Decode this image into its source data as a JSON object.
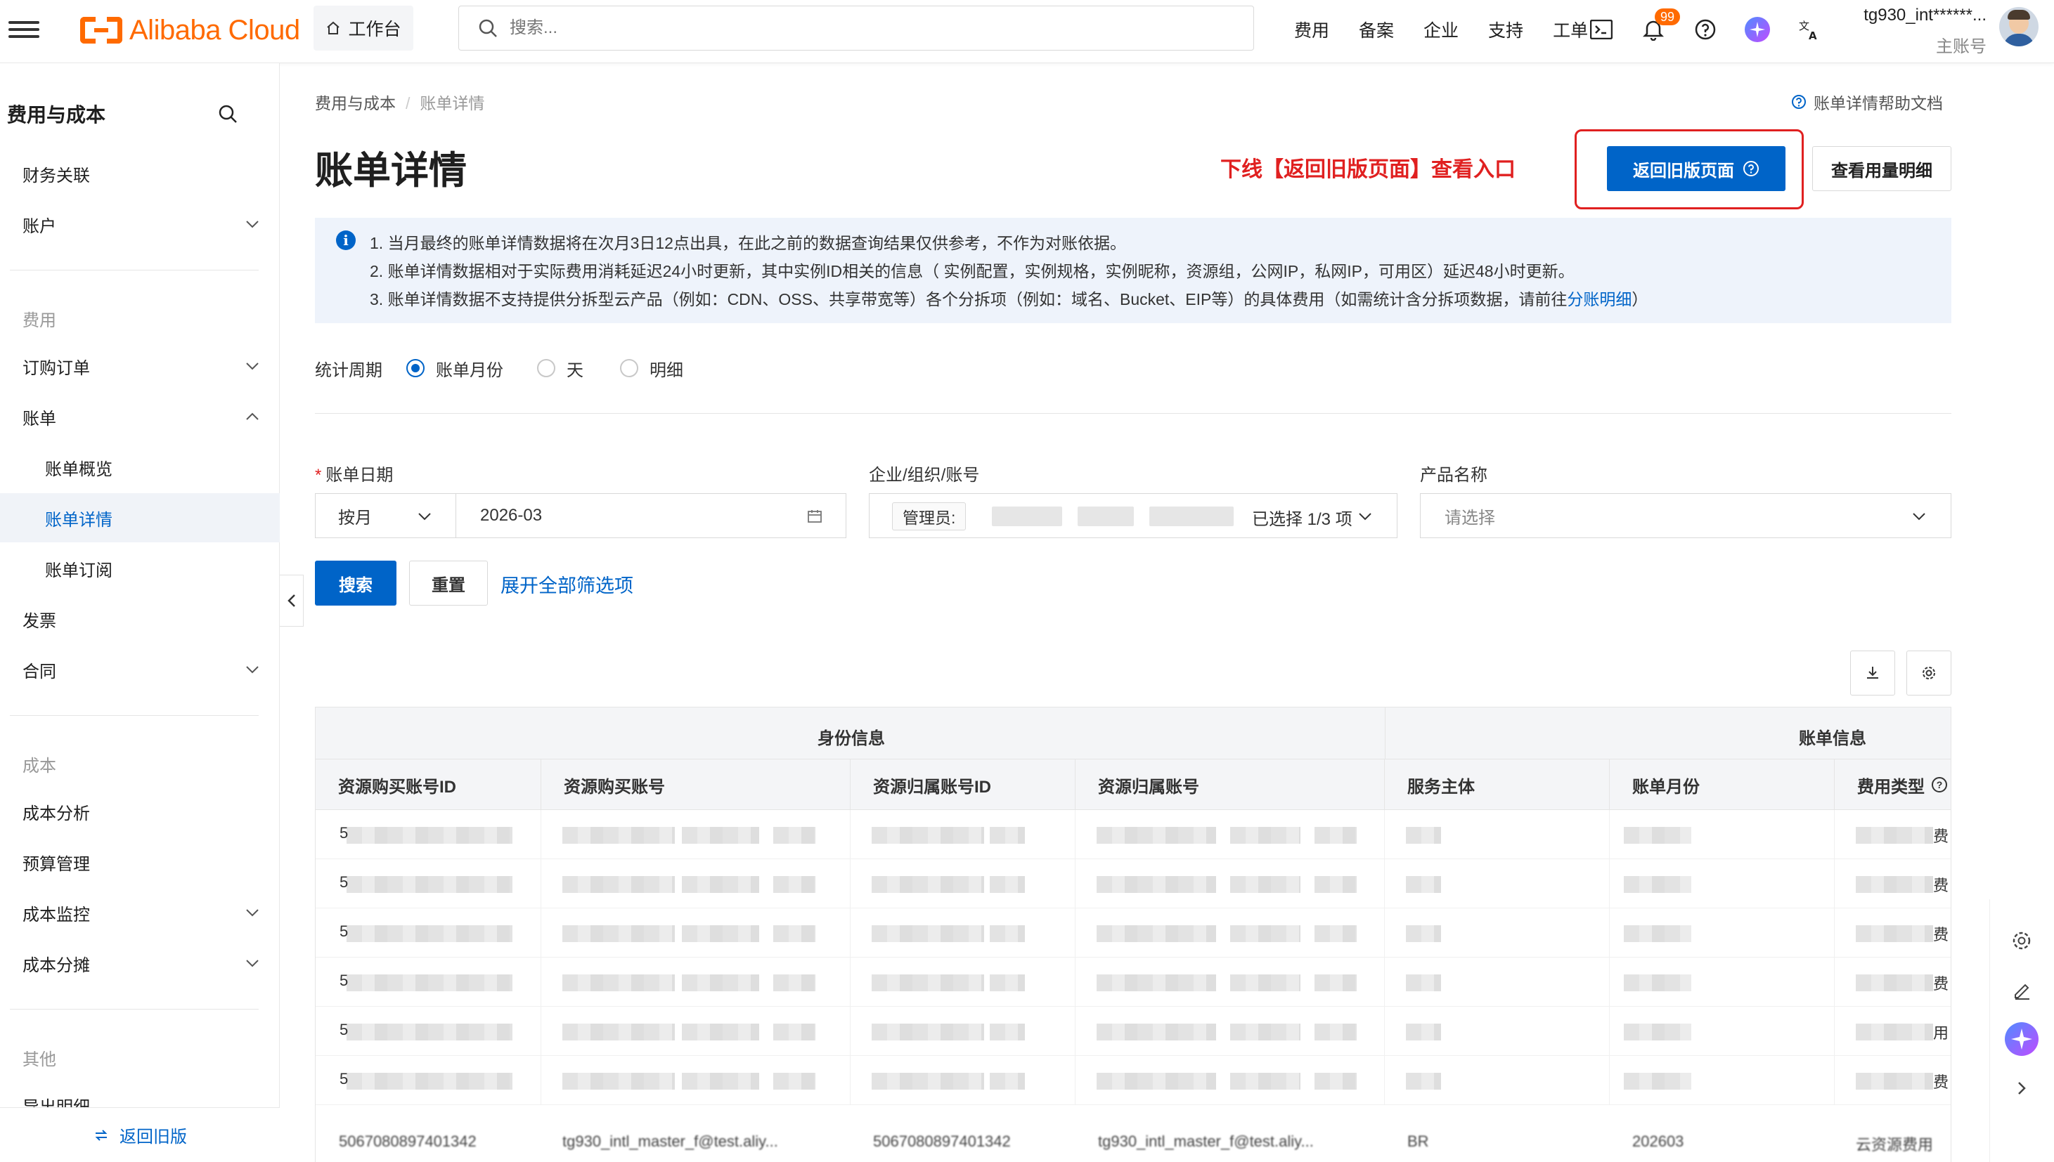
{
  "topbar": {
    "brand": "Alibaba Cloud",
    "workbench": "工作台",
    "search_placeholder": "搜索...",
    "nav": [
      "费用",
      "备案",
      "企业",
      "支持",
      "工单"
    ],
    "notification_count": "99",
    "user_name": "tg930_int******...",
    "user_role": "主账号",
    "accent_color": "#ff6a00"
  },
  "sidebar": {
    "title": "费用与成本",
    "items": [
      {
        "label": "财务关联"
      },
      {
        "label": "账户"
      },
      {
        "label": "订购订单"
      },
      {
        "label": "账单"
      },
      {
        "label": "账单概览"
      },
      {
        "label": "账单详情"
      },
      {
        "label": "账单订阅"
      },
      {
        "label": "发票"
      },
      {
        "label": "合同"
      },
      {
        "label": "成本分析"
      },
      {
        "label": "预算管理"
      },
      {
        "label": "成本监控"
      },
      {
        "label": "成本分摊"
      },
      {
        "label": "导出明细"
      }
    ],
    "groups": [
      "费用",
      "成本",
      "其他"
    ],
    "footer": "返回旧版"
  },
  "breadcrumb": {
    "parent": "费用与成本",
    "current": "账单详情"
  },
  "help_link": "账单详情帮助文档",
  "page_title": "账单详情",
  "annotation": "下线【返回旧版页面】查看入口",
  "buttons": {
    "old_page": "返回旧版页面",
    "usage_detail": "查看用量明细",
    "search": "搜索",
    "reset": "重置",
    "expand": "展开全部筛选项"
  },
  "notice": {
    "line1": "1. 当月最终的账单详情数据将在次月3日12点出具，在此之前的数据查询结果仅供参考，不作为对账依据。",
    "line2": "2. 账单详情数据相对于实际费用消耗延迟24小时更新，其中实例ID相关的信息（ 实例配置，实例规格，实例昵称，资源组，公网IP，私网IP，可用区）延迟48小时更新。",
    "line3_pre": "3. 账单详情数据不支持提供分拆型云产品（例如：CDN、OSS、共享带宽等）各个分拆项（例如：域名、Bucket、EIP等）的具体费用（如需统计含分拆项数据，请前往",
    "line3_link": "分账明细",
    "line3_post": "）"
  },
  "period": {
    "label": "统计周期",
    "options": [
      "账单月份",
      "天",
      "明细"
    ],
    "selected": "账单月份"
  },
  "filters": {
    "date_label": "账单日期",
    "granularity": "按月",
    "date_value": "2026-03",
    "org_label": "企业/组织/账号",
    "org_tag": "管理员:",
    "org_count": "已选择 1/3 项",
    "product_label": "产品名称",
    "product_placeholder": "请选择"
  },
  "table": {
    "groups": [
      "身份信息",
      "账单信息"
    ],
    "columns": [
      "资源购买账号ID",
      "资源购买账号",
      "资源归属账号ID",
      "资源归属账号",
      "服务主体",
      "账单月份",
      "费用类型"
    ],
    "row_leads": [
      "5",
      "5",
      "5",
      "5",
      "5",
      "5"
    ],
    "row_tails": [
      "费",
      "费",
      "费",
      "费",
      "用",
      "费"
    ],
    "last_row": [
      "5067080897401342",
      "tg930_intl_master_f@test.aliy...",
      "5067080897401342",
      "tg930_intl_master_f@test.aliy...",
      "BR",
      "202603",
      "云资源费用"
    ]
  }
}
